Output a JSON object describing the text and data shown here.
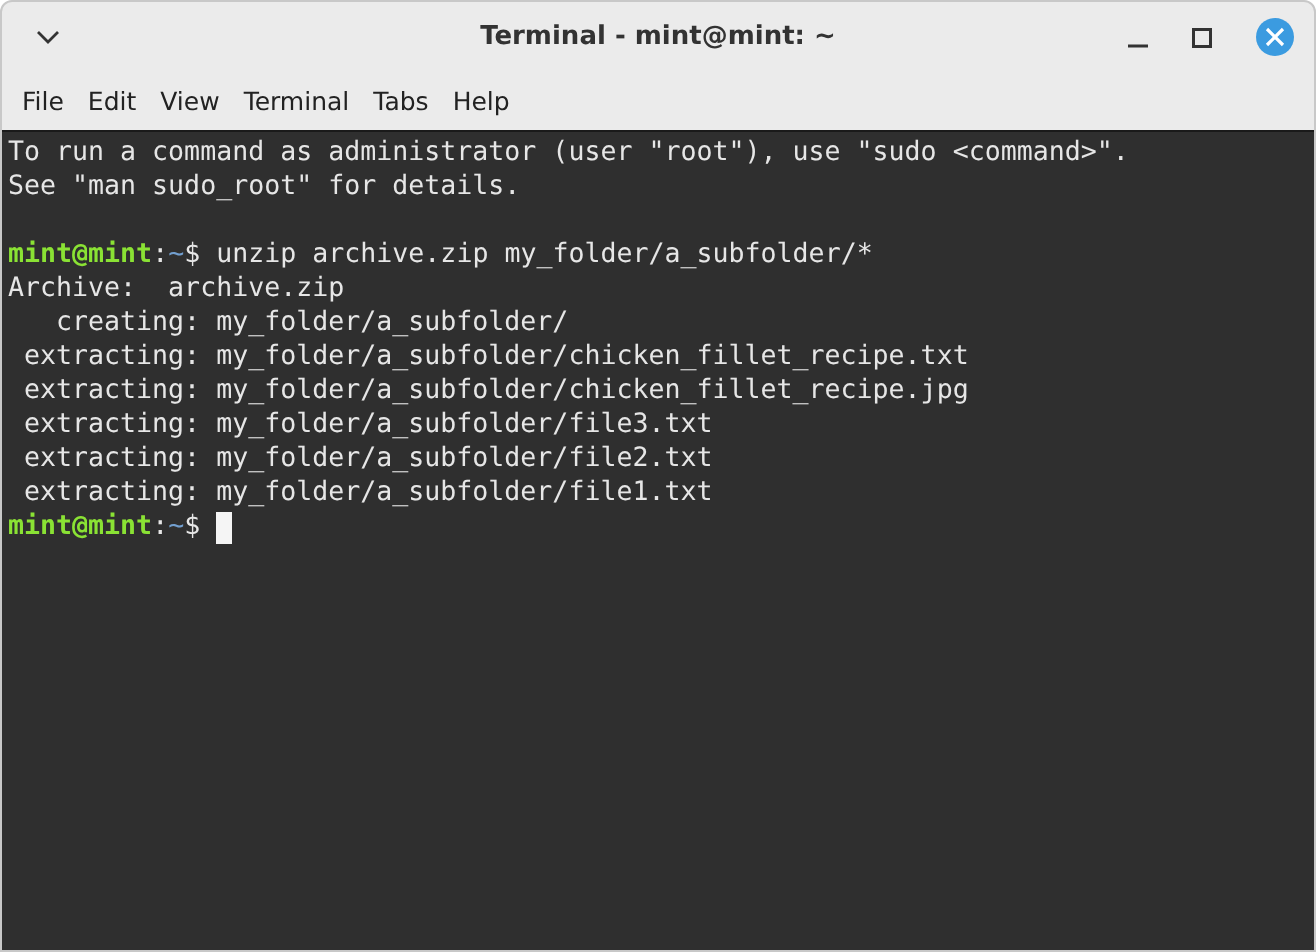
{
  "window": {
    "title": "Terminal - mint@mint: ~"
  },
  "menu": [
    "File",
    "Edit",
    "View",
    "Terminal",
    "Tabs",
    "Help"
  ],
  "lines": [
    {
      "kind": "text",
      "text": "To run a command as administrator (user \"root\"), use \"sudo <command>\"."
    },
    {
      "kind": "text",
      "text": "See \"man sudo_root\" for details."
    },
    {
      "kind": "blank"
    },
    {
      "kind": "prompt",
      "user_host": "mint@mint",
      "separator": ":",
      "path": "~",
      "symbol": "$",
      "command": "unzip archive.zip my_folder/a_subfolder/*",
      "cursor": false
    },
    {
      "kind": "text",
      "text": "Archive:  archive.zip"
    },
    {
      "kind": "text",
      "text": "   creating: my_folder/a_subfolder/"
    },
    {
      "kind": "text",
      "text": " extracting: my_folder/a_subfolder/chicken_fillet_recipe.txt"
    },
    {
      "kind": "text",
      "text": " extracting: my_folder/a_subfolder/chicken_fillet_recipe.jpg"
    },
    {
      "kind": "text",
      "text": " extracting: my_folder/a_subfolder/file3.txt"
    },
    {
      "kind": "text",
      "text": " extracting: my_folder/a_subfolder/file2.txt"
    },
    {
      "kind": "text",
      "text": " extracting: my_folder/a_subfolder/file1.txt"
    },
    {
      "kind": "prompt",
      "user_host": "mint@mint",
      "separator": ":",
      "path": "~",
      "symbol": "$",
      "cursor": true
    }
  ]
}
